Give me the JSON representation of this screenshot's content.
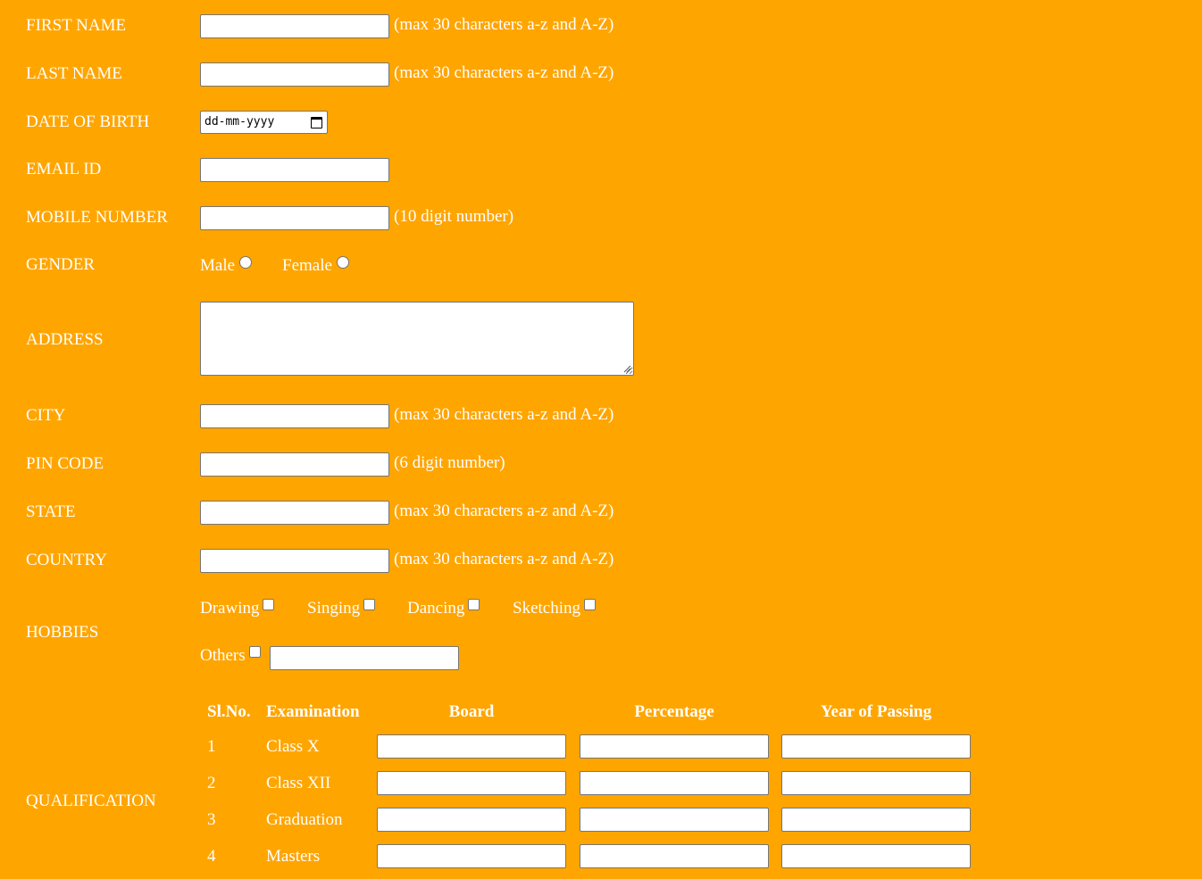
{
  "form": {
    "first_name": {
      "label": "FIRST NAME",
      "hint": "(max 30 characters a-z and A-Z)",
      "value": ""
    },
    "last_name": {
      "label": "LAST NAME",
      "hint": "(max 30 characters a-z and A-Z)",
      "value": ""
    },
    "dob": {
      "label": "DATE OF BIRTH",
      "placeholder": "dd-mm-yyyy"
    },
    "email": {
      "label": "EMAIL ID",
      "value": ""
    },
    "mobile": {
      "label": "MOBILE NUMBER",
      "hint": "(10 digit number)",
      "value": ""
    },
    "gender": {
      "label": "GENDER",
      "options": [
        "Male",
        "Female"
      ]
    },
    "address": {
      "label": "ADDRESS",
      "value": ""
    },
    "city": {
      "label": "CITY",
      "hint": "(max 30 characters a-z and A-Z)",
      "value": ""
    },
    "pin": {
      "label": "PIN CODE",
      "hint": "(6 digit number)",
      "value": ""
    },
    "state": {
      "label": "STATE",
      "hint": "(max 30 characters a-z and A-Z)",
      "value": ""
    },
    "country": {
      "label": "COUNTRY",
      "hint": "(max 30 characters a-z and A-Z)",
      "value": ""
    },
    "hobbies": {
      "label": "HOBBIES",
      "options": [
        "Drawing",
        "Singing",
        "Dancing",
        "Sketching"
      ],
      "others_label": "Others"
    },
    "qualification": {
      "label": "QUALIFICATION",
      "headers": [
        "Sl.No.",
        "Examination",
        "Board",
        "Percentage",
        "Year of Passing"
      ],
      "rows": [
        {
          "no": "1",
          "exam": "Class X"
        },
        {
          "no": "2",
          "exam": "Class XII"
        },
        {
          "no": "3",
          "exam": "Graduation"
        },
        {
          "no": "4",
          "exam": "Masters"
        }
      ]
    }
  },
  "colors": {
    "background": "#FFA500",
    "text": "#ffffff"
  },
  "icons": {
    "date_picker": "calendar-icon",
    "resize": "resize-grip-icon"
  }
}
